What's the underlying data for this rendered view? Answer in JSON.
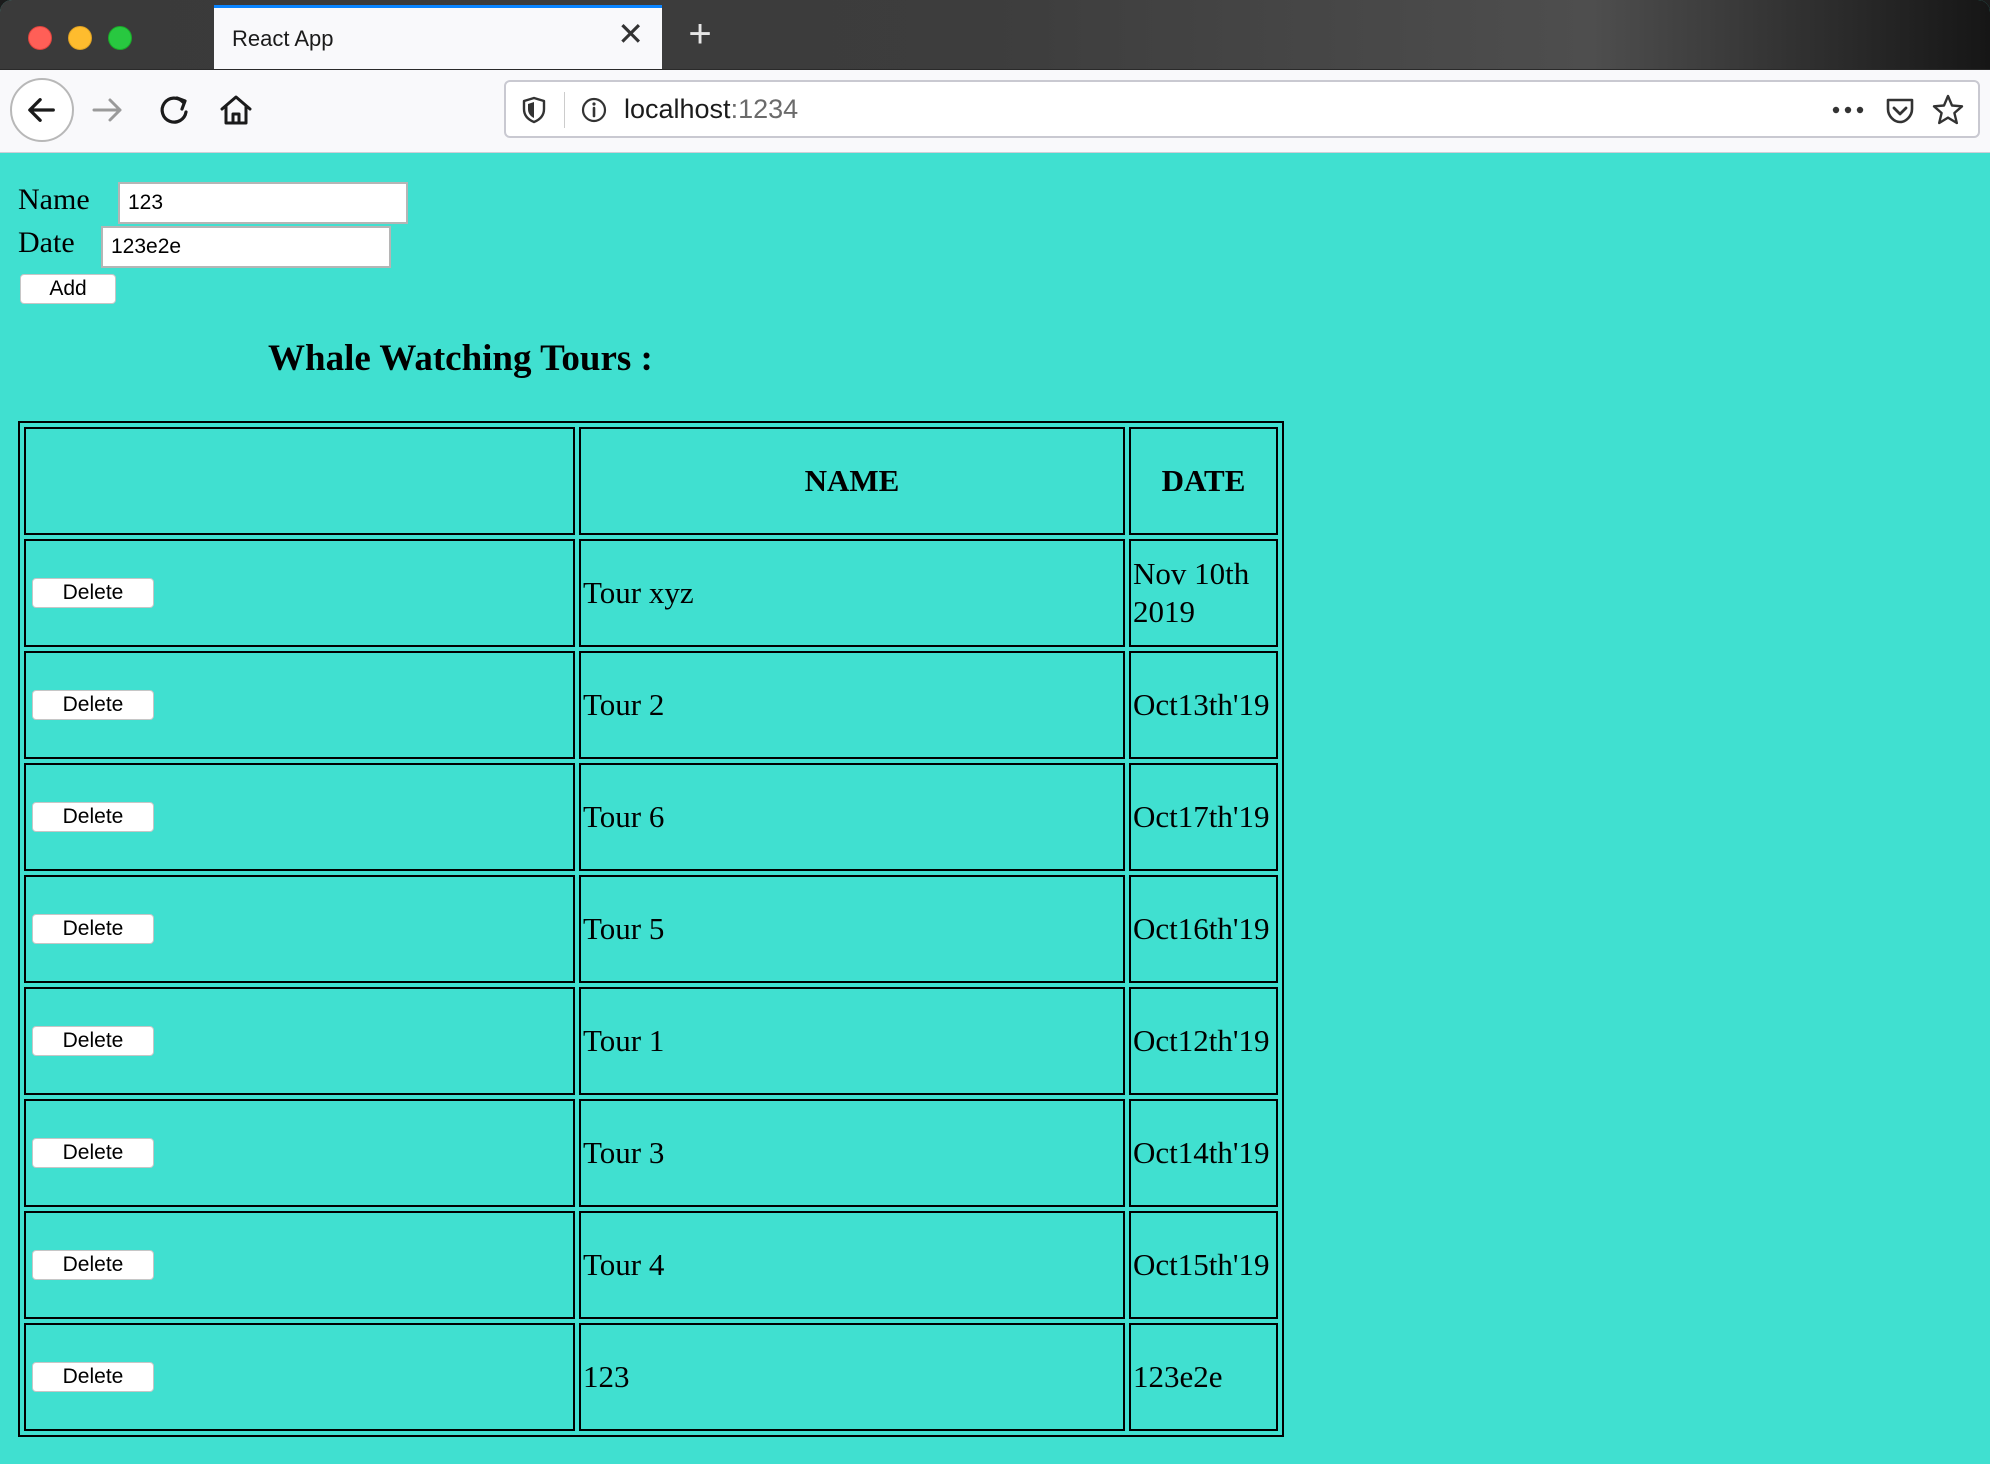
{
  "browser": {
    "tab_title": "React App",
    "tab_close": "✕",
    "new_tab": "+",
    "url_host": "localhost",
    "url_port": ":1234",
    "more": "•••"
  },
  "form": {
    "name_label": "Name",
    "name_value": "123",
    "date_label": "Date",
    "date_value": "123e2e",
    "add_label": "Add"
  },
  "heading": "Whale Watching Tours :",
  "table": {
    "headers": [
      "",
      "NAME",
      "DATE"
    ],
    "delete_label": "Delete",
    "rows": [
      {
        "name": "Tour xyz",
        "date": "Nov 10th 2019"
      },
      {
        "name": "Tour 2",
        "date": "Oct13th'19"
      },
      {
        "name": "Tour 6",
        "date": "Oct17th'19"
      },
      {
        "name": "Tour 5",
        "date": "Oct16th'19"
      },
      {
        "name": "Tour 1",
        "date": "Oct12th'19"
      },
      {
        "name": "Tour 3",
        "date": "Oct14th'19"
      },
      {
        "name": "Tour 4",
        "date": "Oct15th'19"
      },
      {
        "name": "123",
        "date": "123e2e"
      }
    ]
  },
  "colors": {
    "page_background": "#40e0d0",
    "tab_accent": "#0a84ff"
  }
}
